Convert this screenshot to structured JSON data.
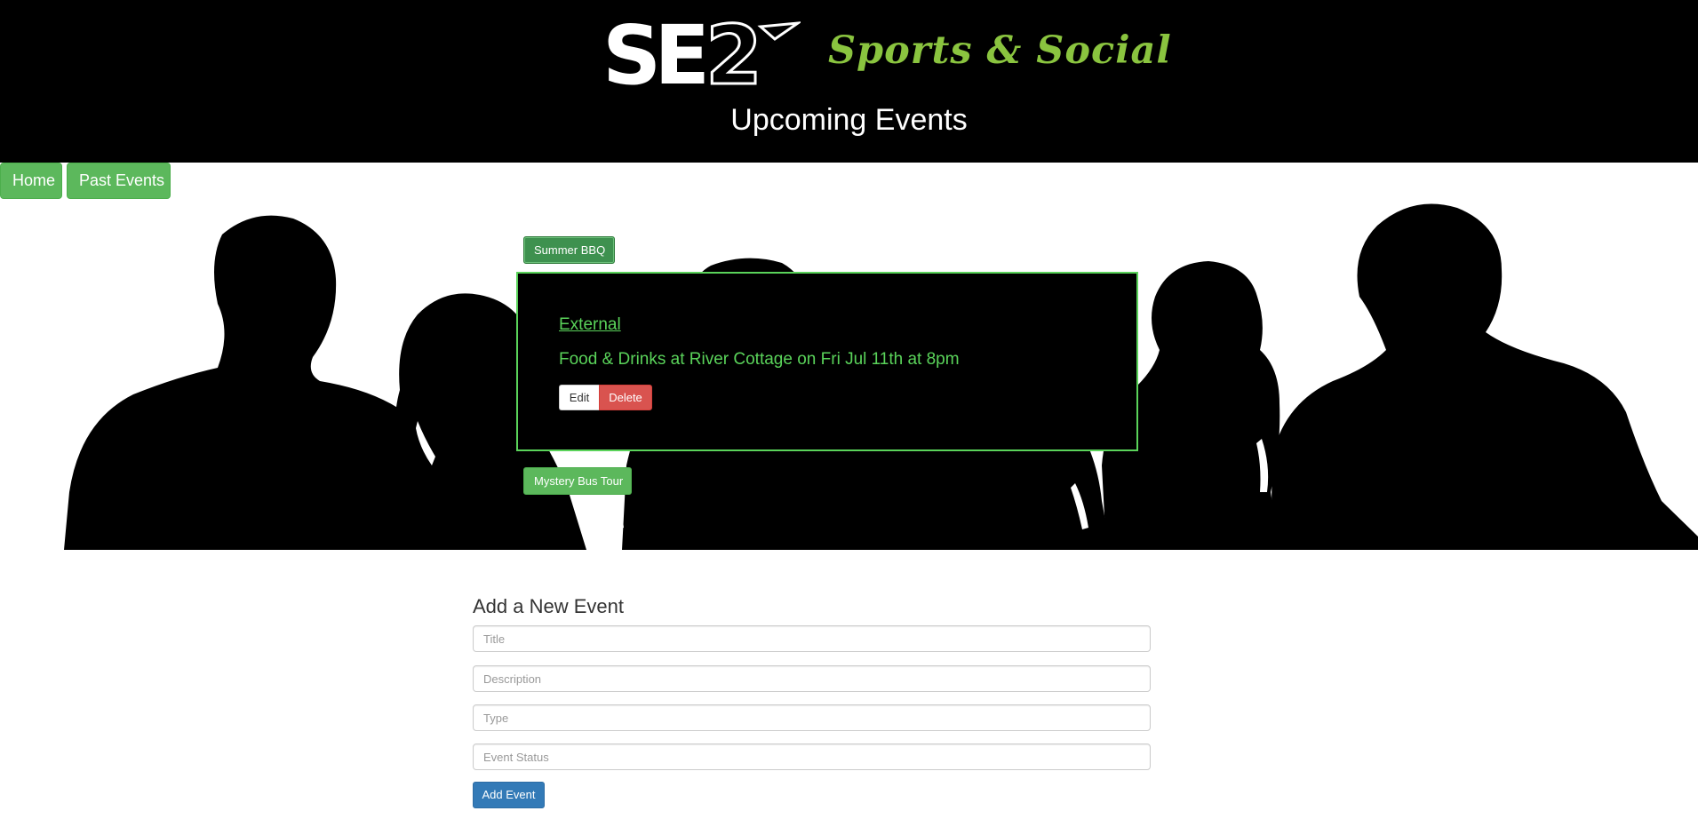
{
  "header": {
    "logo_text": "SE2",
    "tagline": "Sports & Social",
    "title": "Upcoming Events"
  },
  "nav": {
    "home_label": "Home",
    "past_events_label": "Past Events"
  },
  "events": {
    "items": [
      {
        "title": "Summer BBQ",
        "expanded": true,
        "type": "External",
        "description": "Food & Drinks at River Cottage on Fri Jul 11th at 8pm",
        "edit_label": "Edit",
        "delete_label": "Delete"
      },
      {
        "title": "Mystery Bus Tour",
        "expanded": false
      }
    ]
  },
  "form": {
    "heading": "Add a New Event",
    "title_placeholder": "Title",
    "description_placeholder": "Description",
    "type_placeholder": "Type",
    "status_placeholder": "Event Status",
    "submit_label": "Add Event"
  },
  "colors": {
    "header_bg": "#000000",
    "tagline_green": "#8ac43f",
    "event_green": "#5ad35a",
    "button_green": "#5cb85c",
    "delete_red": "#d9534f",
    "primary_blue": "#337ab7"
  },
  "icons": {
    "logo": "se2-logo-icon",
    "hero": "people-silhouette-image"
  }
}
